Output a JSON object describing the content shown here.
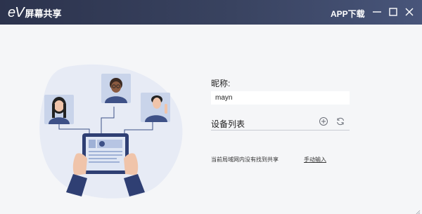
{
  "header": {
    "logo_ev": "eV",
    "logo_text": "屏幕共享",
    "app_download": "APP下载"
  },
  "form": {
    "nickname_label": "昵称:",
    "nickname_value": "mayn",
    "device_list_label": "设备列表"
  },
  "status": {
    "no_share_text": "当前局域网内没有找到共享",
    "manual_input": "手动输入"
  },
  "colors": {
    "titlebar": "#2c334d",
    "background": "#f5f6f8",
    "illustration_accent": "#3e5187"
  },
  "icons": [
    "minimize-icon",
    "maximize-icon",
    "close-icon",
    "add-icon",
    "refresh-icon"
  ]
}
